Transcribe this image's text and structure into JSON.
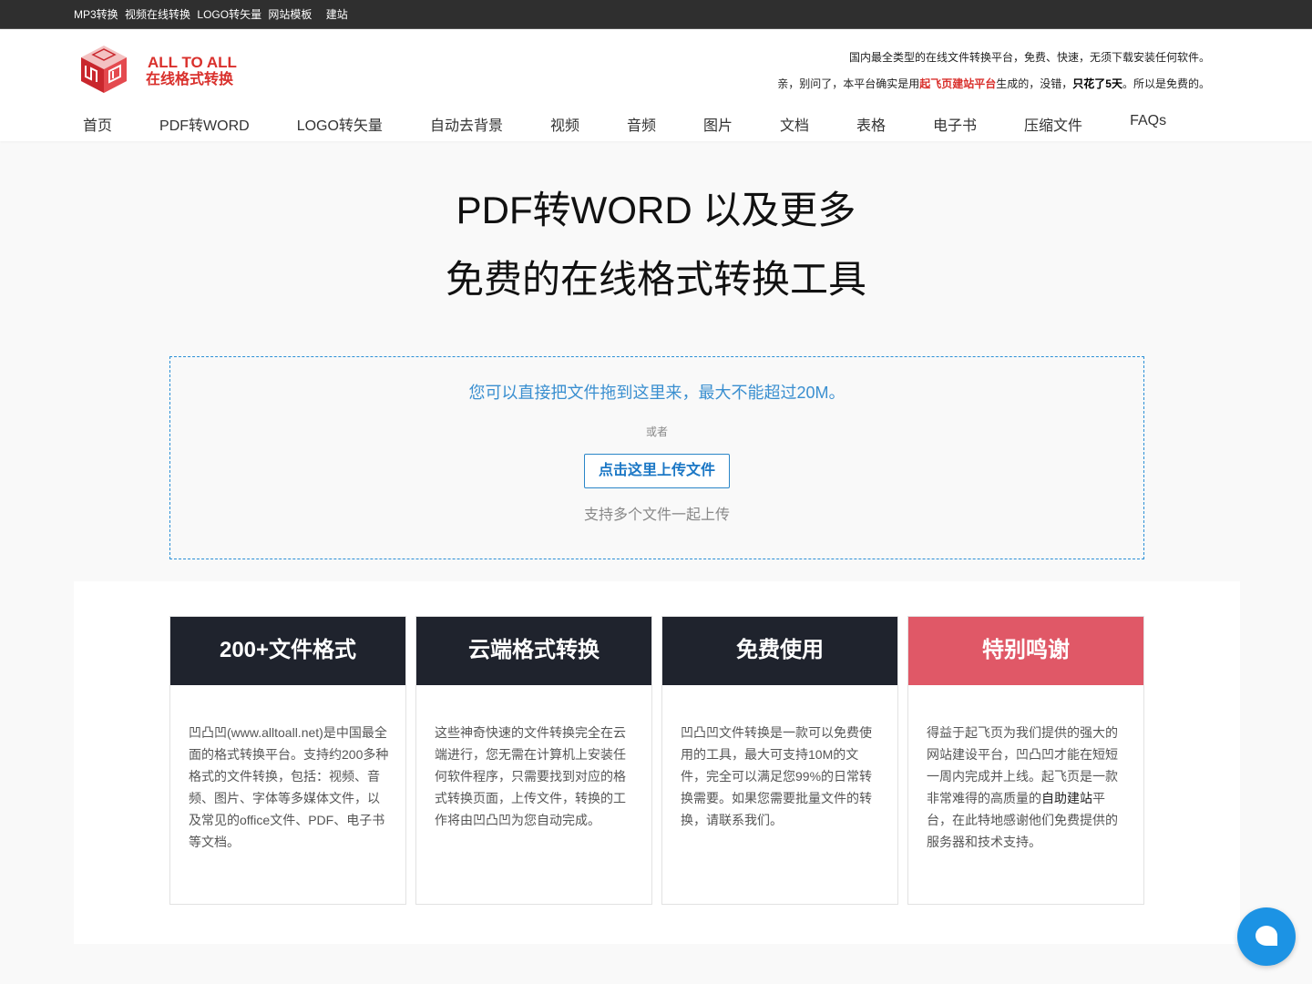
{
  "topbar": {
    "links": [
      "MP3转换",
      "视频在线转换",
      "LOGO转矢量",
      "网站模板",
      "建站"
    ]
  },
  "brand": {
    "en": "ALL TO ALL",
    "cn": "在线格式转换",
    "color": "#d9302c"
  },
  "notice": {
    "line1": "国内最全类型的在线文件转换平台，免费、快速，无须下载安装任何软件。",
    "line2_a": "亲，别问了，本平台确实是用",
    "line2_link": "起飞页建站平台",
    "line2_b": "生成的，没错，",
    "line2_bold": "只花了5天",
    "line2_c": "。所以是免费的。"
  },
  "nav": [
    "首页",
    "PDF转WORD",
    "LOGO转矢量",
    "自动去背景",
    "视频",
    "音频",
    "图片",
    "文档",
    "表格",
    "电子书",
    "压缩文件",
    "FAQs"
  ],
  "hero": {
    "title1": "PDF转WORD 以及更多",
    "title2": "免费的在线格式转换工具"
  },
  "dropzone": {
    "main": "您可以直接把文件拖到这里来，最大不能超过20M。",
    "or": "或者",
    "button": "点击这里上传文件",
    "multi": "支持多个文件一起上传"
  },
  "features": [
    {
      "title": "200+文件格式",
      "body": "凹凸凹(www.alltoall.net)是中国最全面的格式转换平台。支持约200多种格式的文件转换，包括：视频、音频、图片、字体等多媒体文件，以及常见的office文件、PDF、电子书等文档。"
    },
    {
      "title": "云端格式转换",
      "body": "这些神奇快速的文件转换完全在云端进行，您无需在计算机上安装任何软件程序，只需要找到对应的格式转换页面，上传文件，转换的工作将由凹凸凹为您自动完成。"
    },
    {
      "title": "免费使用",
      "body": "凹凸凹文件转换是一款可以免费使用的工具，最大可支持10M的文件，完全可以满足您99%的日常转换需要。如果您需要批量文件的转换，请联系我们。"
    },
    {
      "title": "特别鸣谢",
      "body_a": "得益于起飞页为我们提供的强大的网站建设平台，凹凸凹才能在短短一周内完成并上线。起飞页是一款非常难得的高质量的",
      "body_link": "自助建站",
      "body_b": "平台，在此特地感谢他们免费提供的服务器和技术支持。"
    }
  ],
  "colors": {
    "accent_blue": "#1c93e4",
    "card_dark": "#1f232d",
    "card_red": "#e05867"
  },
  "icons": [
    "logo-cube-icon",
    "chat-bubble-icon"
  ]
}
